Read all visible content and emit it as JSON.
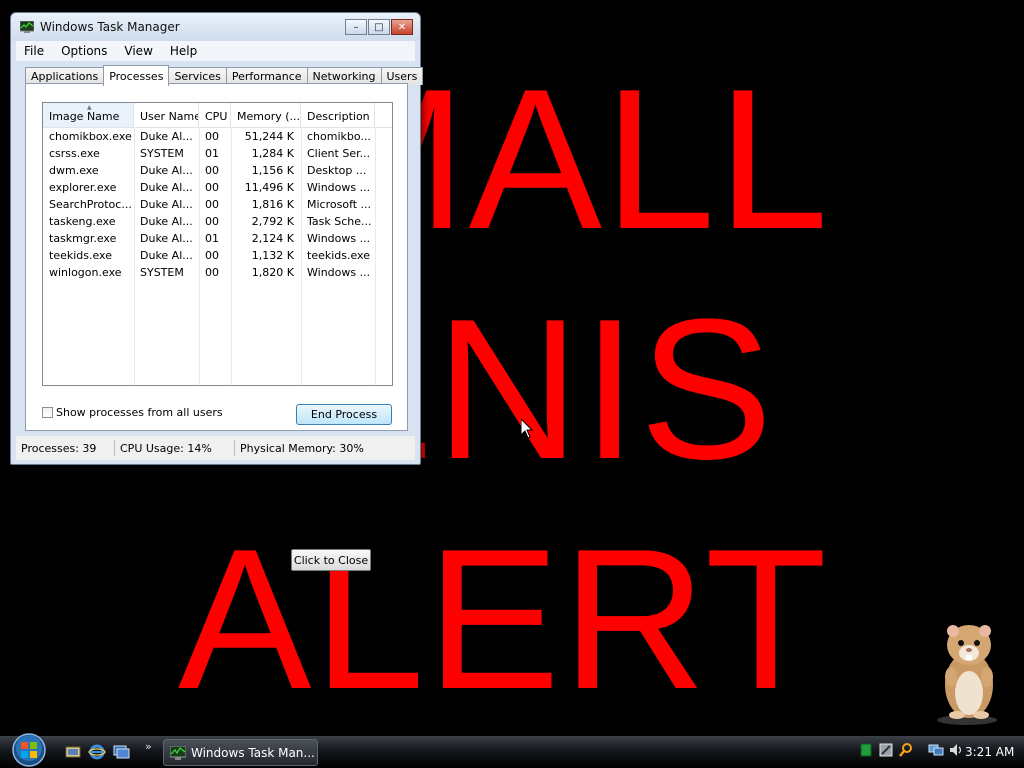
{
  "background": {
    "lines": [
      "MALL",
      "ENIS",
      "ALERT"
    ],
    "text_color": "#ff0000"
  },
  "close_button_label": "Click to Close",
  "window": {
    "title": "Windows Task Manager",
    "menu": [
      "File",
      "Options",
      "View",
      "Help"
    ],
    "tabs": [
      "Applications",
      "Processes",
      "Services",
      "Performance",
      "Networking",
      "Users"
    ],
    "active_tab": "Processes",
    "columns": [
      "Image Name",
      "User Name",
      "CPU",
      "Memory (...",
      "Description"
    ],
    "rows": [
      {
        "name": "chomikbox.exe",
        "user": "Duke Al...",
        "cpu": "00",
        "mem": "51,244 K",
        "desc": "chomikbo..."
      },
      {
        "name": "csrss.exe",
        "user": "SYSTEM",
        "cpu": "01",
        "mem": "1,284 K",
        "desc": "Client Ser..."
      },
      {
        "name": "dwm.exe",
        "user": "Duke Al...",
        "cpu": "00",
        "mem": "1,156 K",
        "desc": "Desktop ..."
      },
      {
        "name": "explorer.exe",
        "user": "Duke Al...",
        "cpu": "00",
        "mem": "11,496 K",
        "desc": "Windows ..."
      },
      {
        "name": "SearchProtoc...",
        "user": "Duke Al...",
        "cpu": "00",
        "mem": "1,816 K",
        "desc": "Microsoft ..."
      },
      {
        "name": "taskeng.exe",
        "user": "Duke Al...",
        "cpu": "00",
        "mem": "2,792 K",
        "desc": "Task Sche..."
      },
      {
        "name": "taskmgr.exe",
        "user": "Duke Al...",
        "cpu": "01",
        "mem": "2,124 K",
        "desc": "Windows ..."
      },
      {
        "name": "teekids.exe",
        "user": "Duke Al...",
        "cpu": "00",
        "mem": "1,132 K",
        "desc": "teekids.exe"
      },
      {
        "name": "winlogon.exe",
        "user": "SYSTEM",
        "cpu": "00",
        "mem": "1,820 K",
        "desc": "Windows ..."
      }
    ],
    "show_all_label": "Show processes from all users",
    "show_all_checked": false,
    "end_process_label": "End Process",
    "status": {
      "processes": "Processes: 39",
      "cpu": "CPU Usage: 14%",
      "memory": "Physical Memory: 30%"
    }
  },
  "taskbar": {
    "task_button_label": "Windows Task Man...",
    "clock": "3:21 AM",
    "quick_launch_icons": [
      "show-desktop-icon",
      "internet-explorer-icon",
      "switch-windows-icon"
    ],
    "tray_icons": [
      "green-square-icon",
      "tool-icon",
      "search-icon",
      "network-icon",
      "volume-icon"
    ]
  }
}
